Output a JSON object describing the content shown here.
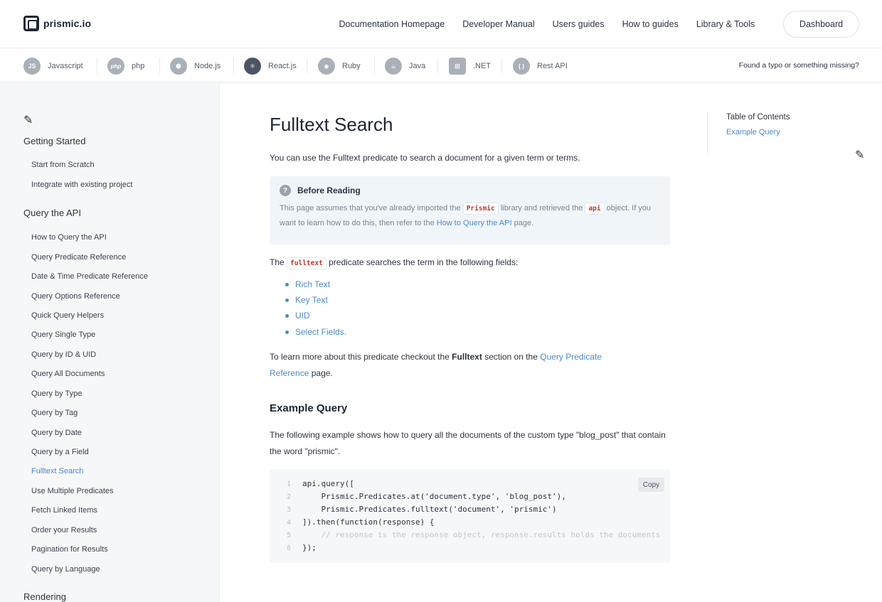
{
  "header": {
    "logo_text": "prismic.io",
    "nav": [
      "Documentation Homepage",
      "Developer Manual",
      "Users guides",
      "How to guides",
      "Library & Tools"
    ],
    "dashboard_label": "Dashboard"
  },
  "techbar": {
    "items": [
      {
        "label": "Javascript",
        "icon_text": "JS",
        "icon": "javascript-icon"
      },
      {
        "label": "php",
        "icon_text": "php",
        "icon": "php-icon"
      },
      {
        "label": "Node.js",
        "icon_text": "⬢",
        "icon": "nodejs-icon"
      },
      {
        "label": "React.js",
        "icon_text": "⚛",
        "icon": "react-icon"
      },
      {
        "label": "Ruby",
        "icon_text": "◆",
        "icon": "ruby-icon"
      },
      {
        "label": "Java",
        "icon_text": "☕",
        "icon": "java-icon"
      },
      {
        "label": ".NET",
        "icon_text": "⊞",
        "icon": "dotnet-icon"
      },
      {
        "label": "Rest API",
        "icon_text": "{ }",
        "icon": "rest-api-icon"
      }
    ],
    "active": "React.js",
    "typo_link": "Found a typo or something missing?"
  },
  "sidebar": {
    "sections": [
      {
        "title": "Getting Started",
        "items": [
          "Start from Scratch",
          "Integrate with existing project"
        ]
      },
      {
        "title": "Query the API",
        "items": [
          "How to Query the API",
          "Query Predicate Reference",
          "Date & Time Predicate Reference",
          "Query Options Reference",
          "Quick Query Helpers",
          "Query Single Type",
          "Query by ID & UID",
          "Query All Documents",
          "Query by Type",
          "Query by Tag",
          "Query by Date",
          "Query by a Field",
          "Fulltext Search",
          "Use Multiple Predicates",
          "Fetch Linked Items",
          "Order your Results",
          "Pagination for Results",
          "Query by Language"
        ]
      },
      {
        "title": "Rendering",
        "items": []
      }
    ],
    "active_item": "Fulltext Search"
  },
  "main": {
    "title": "Fulltext Search",
    "intro": "You can use the Fulltext predicate to search a document for a given term or terms.",
    "before_reading": {
      "title": "Before Reading",
      "t1": "This page assumes that you've already imported the",
      "code1": "Prismic",
      "t2": "library and retrieved the",
      "code2": "api",
      "t3": "object. If you want to learn how to do this, then refer to the",
      "link": "How to Query the API",
      "t4": "page."
    },
    "fields_pre": "The",
    "fields_code": "fulltext",
    "fields_post": "predicate searches the term in the following fields:",
    "fields": [
      "Rich Text",
      "Key Text",
      "UID",
      "Select Fields."
    ],
    "learn_pre": "To learn more about this predicate checkout the",
    "learn_bold": "Fulltext",
    "learn_mid": "section on the",
    "learn_link": "Query Predicate Reference",
    "learn_post": "page.",
    "example_heading": "Example Query",
    "example_text": "The following example shows how to query all the documents of the custom type \"blog_post\" that contain the word \"prismic\".",
    "copy_label": "Copy",
    "code_lines": [
      {
        "n": "1",
        "text": "api.query(["
      },
      {
        "n": "2",
        "text": "    Prismic.Predicates.at('document.type', 'blog_post'),"
      },
      {
        "n": "3",
        "text": "    Prismic.Predicates.fulltext('document', 'prismic')"
      },
      {
        "n": "4",
        "text": "]).then(function(response) {"
      },
      {
        "n": "5",
        "text": "    // response is the response object, response.results holds the documents"
      },
      {
        "n": "6",
        "text": "});"
      }
    ]
  },
  "toc": {
    "title": "Table of Contents",
    "items": [
      "Example Query"
    ]
  },
  "colors": {
    "link": "#4c8ac9",
    "code_red": "#c0392b",
    "sidebar_bg": "#f6f7f8",
    "info_bg": "#f0f5fa"
  }
}
